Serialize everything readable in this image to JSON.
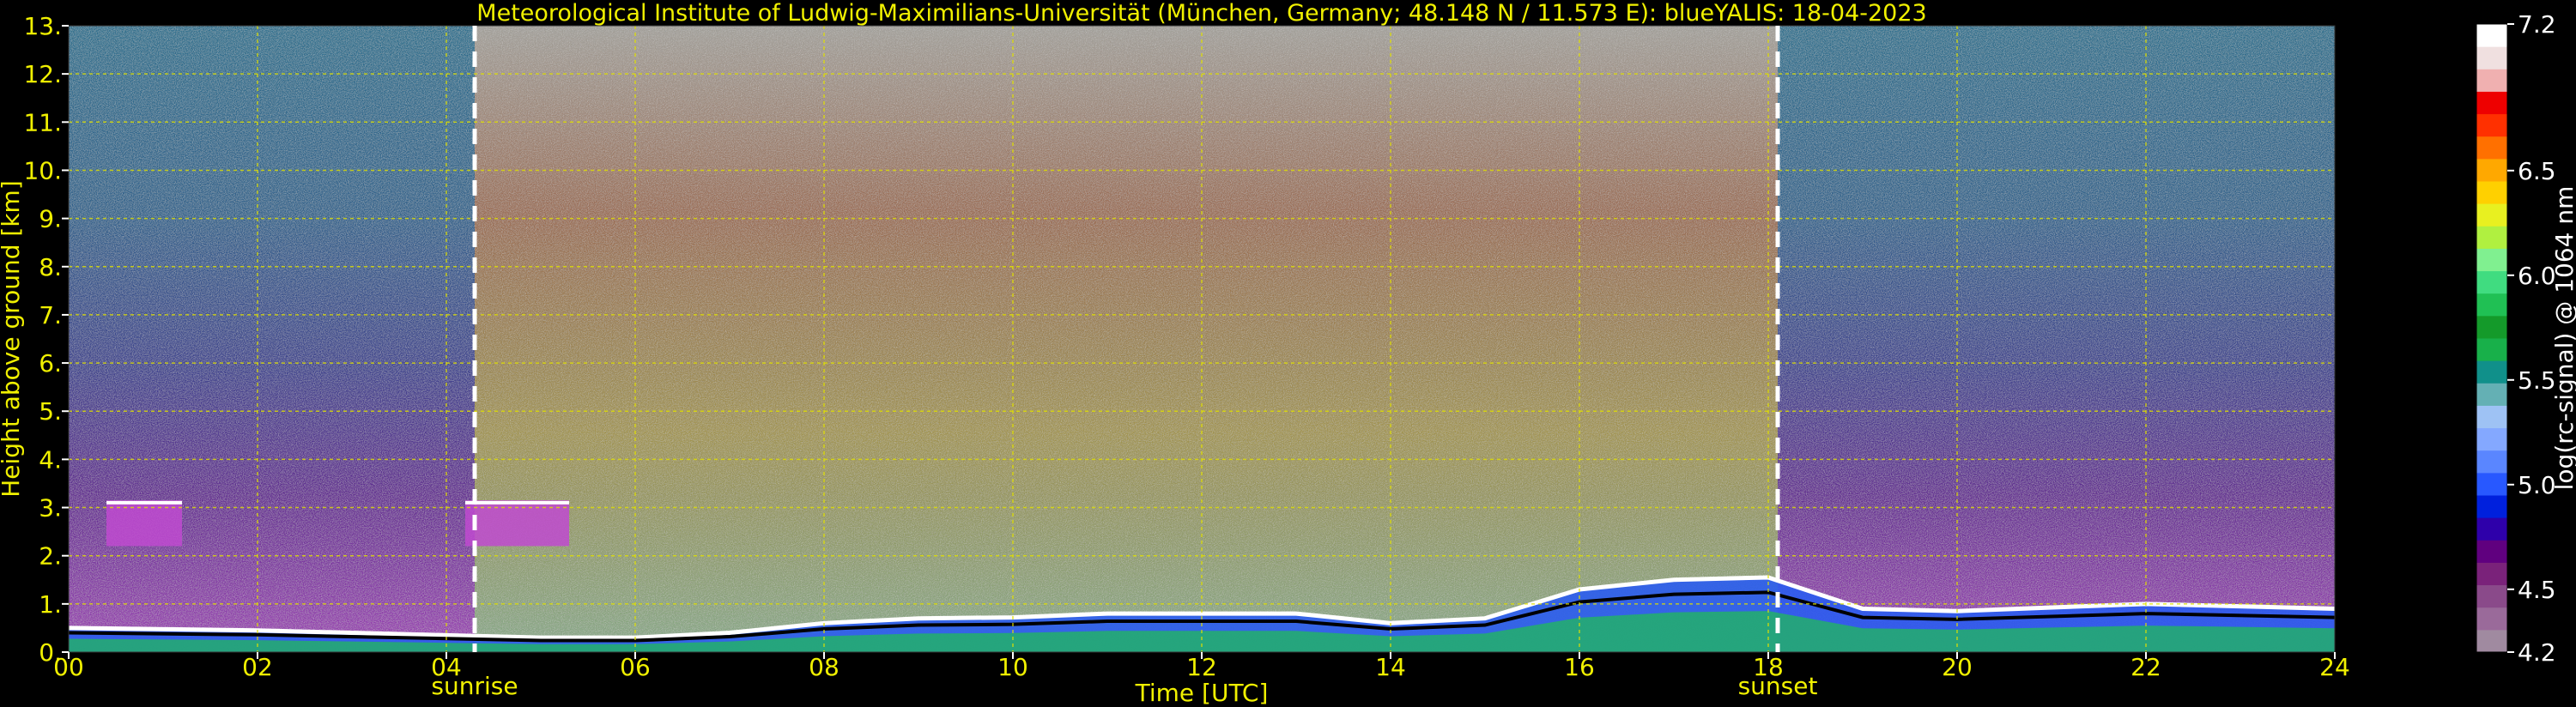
{
  "chart_data": {
    "type": "heatmap",
    "title": "Meteorological Institute of Ludwig-Maximilians-Universität (München, Germany; 48.148 N / 11.573 E):    blueYALIS: 18-04-2023",
    "xlabel": "Time [UTC]",
    "ylabel": "Height above ground [km]",
    "colorbar_label": "log(rc-signal) @ 1064 nm",
    "xlim": [
      0,
      24
    ],
    "ylim": [
      0,
      13
    ],
    "x_ticks": [
      0,
      2,
      4,
      6,
      8,
      10,
      12,
      14,
      16,
      18,
      20,
      22,
      24
    ],
    "x_tick_labels": [
      "00",
      "02",
      "04",
      "06",
      "08",
      "10",
      "12",
      "14",
      "16",
      "18",
      "20",
      "22",
      "24"
    ],
    "y_ticks": [
      0,
      1,
      2,
      3,
      4,
      5,
      6,
      7,
      8,
      9,
      10,
      11,
      12,
      13
    ],
    "y_tick_labels": [
      "0.",
      "1.",
      "2.",
      "3.",
      "4.",
      "5.",
      "6.",
      "7.",
      "8.",
      "9.",
      "10.",
      "11.",
      "12.",
      "13."
    ],
    "grid": true,
    "colorbar": {
      "min": 4.2,
      "max": 7.2,
      "ticks": [
        4.2,
        4.5,
        5.0,
        5.5,
        6.0,
        6.5,
        7.2
      ],
      "tick_labels": [
        "4.2",
        "4.5",
        "5.0",
        "5.5",
        "6.0",
        "6.5",
        "7.2"
      ],
      "colors": [
        "#a08aa0",
        "#9a6a9a",
        "#8a4a8a",
        "#7a227a",
        "#60007f",
        "#2e00aa",
        "#0020dd",
        "#2858ff",
        "#5a86ff",
        "#84a8ff",
        "#9ec2f4",
        "#64b0b4",
        "#10908a",
        "#18b04a",
        "#149a2a",
        "#20c054",
        "#40dc80",
        "#80f090",
        "#b0f040",
        "#e8f020",
        "#ffd000",
        "#ffa800",
        "#ff7000",
        "#ff3000",
        "#ee0000",
        "#f0b0b0",
        "#f0e0e0",
        "#ffffff"
      ]
    },
    "annotations": [
      {
        "x": 4.3,
        "label": "sunrise"
      },
      {
        "x": 18.1,
        "label": "sunset"
      }
    ],
    "features": [
      {
        "name": "boundary-layer-top",
        "points": [
          [
            0,
            0.5
          ],
          [
            2,
            0.45
          ],
          [
            4,
            0.35
          ],
          [
            5,
            0.3
          ],
          [
            6,
            0.3
          ],
          [
            7,
            0.4
          ],
          [
            8,
            0.6
          ],
          [
            9,
            0.7
          ],
          [
            10,
            0.72
          ],
          [
            11,
            0.8
          ],
          [
            12,
            0.8
          ],
          [
            13,
            0.8
          ],
          [
            14,
            0.6
          ],
          [
            15,
            0.7
          ],
          [
            16,
            1.3
          ],
          [
            17,
            1.5
          ],
          [
            18,
            1.55
          ],
          [
            19,
            0.9
          ],
          [
            20,
            0.85
          ],
          [
            22,
            1.0
          ],
          [
            24,
            0.9
          ]
        ]
      },
      {
        "name": "cloud-layer",
        "points": [
          [
            0.4,
            3.0
          ],
          [
            1.2,
            3.0
          ],
          [
            4.2,
            3.0
          ],
          [
            5.3,
            3.0
          ],
          [
            6.0,
            2.9
          ]
        ]
      }
    ]
  }
}
